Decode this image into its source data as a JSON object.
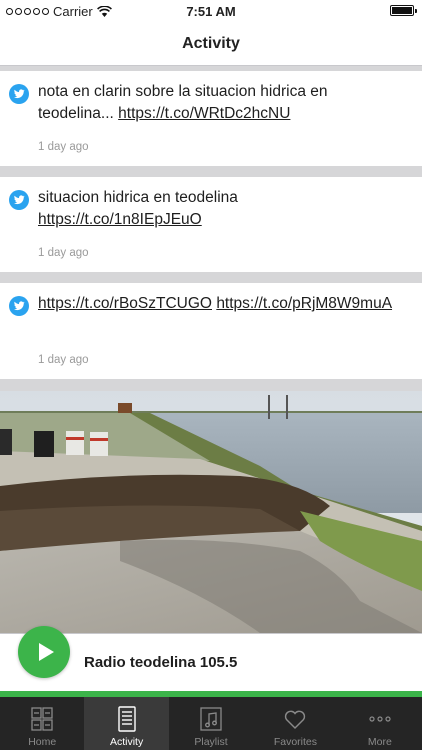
{
  "status_bar": {
    "carrier": "Carrier",
    "time": "7:51 AM",
    "battery_level": 1.0,
    "signal_bars": 5,
    "icons": [
      "signal-dots-icon",
      "wifi-icon",
      "battery-icon"
    ]
  },
  "nav": {
    "title": "Activity"
  },
  "tweets": [
    {
      "text": "nota en clarin sobre la situacion hidrica en teodelina... ",
      "link1": "https://t.co/WRtDc2hcNU",
      "link2": "",
      "time": "1 day ago"
    },
    {
      "text": "situacion hidrica en teodelina ",
      "link1": "https://t.co/1n8IEpJEuO",
      "link2": "",
      "time": "1 day ago"
    },
    {
      "text": "",
      "link1": "https://t.co/rBoSzTCUGO",
      "link2": "https://t.co/pRjM8W9muA",
      "time": "1 day ago"
    }
  ],
  "player": {
    "station": "Radio teodelina 105.5",
    "progress": 1.0,
    "accent_color": "#3cb44a"
  },
  "tabs": [
    {
      "label": "Home",
      "icon": "home-grid-icon",
      "active": false
    },
    {
      "label": "Activity",
      "icon": "activity-list-icon",
      "active": true
    },
    {
      "label": "Playlist",
      "icon": "playlist-music-icon",
      "active": false
    },
    {
      "label": "Favorites",
      "icon": "heart-icon",
      "active": false
    },
    {
      "label": "More",
      "icon": "more-dots-icon",
      "active": false
    }
  ]
}
